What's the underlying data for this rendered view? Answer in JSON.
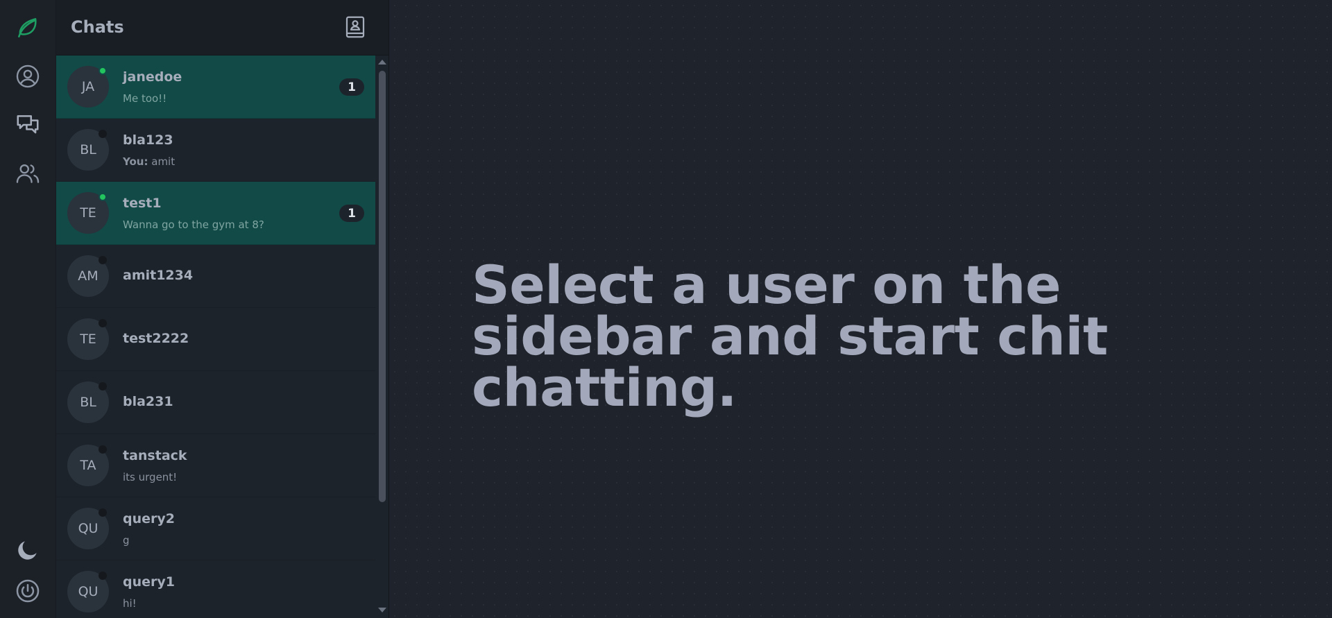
{
  "colors": {
    "accent": "#22c55e",
    "unread_row": "#124a48",
    "panel_bg": "#1d232a",
    "rail_bg": "#1c2027",
    "text": "#a6adbb"
  },
  "rail": {
    "icons": [
      "leaf-logo-icon",
      "profile-icon",
      "chats-icon",
      "users-icon",
      "moon-icon",
      "power-icon"
    ]
  },
  "chats": {
    "title": "Chats",
    "contacts_icon": "address-book-icon",
    "items": [
      {
        "initials": "JA",
        "name": "janedoe",
        "preview_prefix": "",
        "preview": "Me too!!",
        "unread": "1",
        "online": true
      },
      {
        "initials": "BL",
        "name": "bla123",
        "preview_prefix": "You:",
        "preview": "amit",
        "unread": "",
        "online": false
      },
      {
        "initials": "TE",
        "name": "test1",
        "preview_prefix": "",
        "preview": "Wanna go to the gym at 8?",
        "unread": "1",
        "online": true
      },
      {
        "initials": "AM",
        "name": "amit1234",
        "preview_prefix": "",
        "preview": "",
        "unread": "",
        "online": false
      },
      {
        "initials": "TE",
        "name": "test2222",
        "preview_prefix": "",
        "preview": "",
        "unread": "",
        "online": false
      },
      {
        "initials": "BL",
        "name": "bla231",
        "preview_prefix": "",
        "preview": "",
        "unread": "",
        "online": false
      },
      {
        "initials": "TA",
        "name": "tanstack",
        "preview_prefix": "",
        "preview": "its urgent!",
        "unread": "",
        "online": false
      },
      {
        "initials": "QU",
        "name": "query2",
        "preview_prefix": "",
        "preview": "g",
        "unread": "",
        "online": false
      },
      {
        "initials": "QU",
        "name": "query1",
        "preview_prefix": "",
        "preview": "hi!",
        "unread": "",
        "online": false
      }
    ]
  },
  "main": {
    "empty_message": "Select a user on the sidebar and start chit chatting."
  }
}
